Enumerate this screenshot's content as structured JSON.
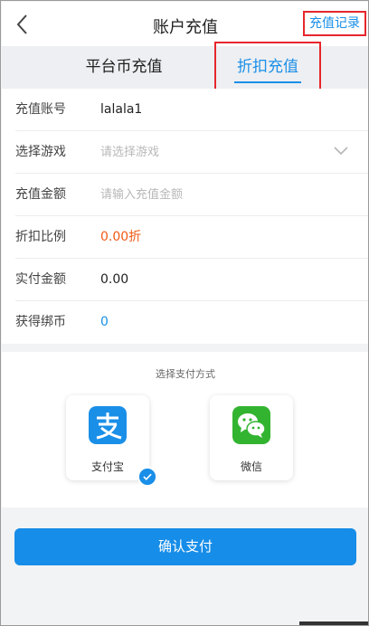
{
  "header": {
    "title": "账户充值",
    "history_label": "充值记录",
    "back_icon": "chevron-left-icon"
  },
  "tabs": [
    {
      "label": "平台币充值",
      "active": false
    },
    {
      "label": "折扣充值",
      "active": true
    }
  ],
  "form": {
    "account": {
      "label": "充值账号",
      "value": "lalala1"
    },
    "game": {
      "label": "选择游戏",
      "placeholder": "请选择游戏",
      "icon": "chevron-down-icon"
    },
    "amount": {
      "label": "充值金额",
      "placeholder": "请输入充值金额"
    },
    "discount": {
      "label": "折扣比例",
      "value": "0.00折"
    },
    "pay_amount": {
      "label": "实付金额",
      "value": "0.00"
    },
    "bonus": {
      "label": "获得绑币",
      "value": "0"
    }
  },
  "payment": {
    "title": "选择支付方式",
    "methods": [
      {
        "label": "支付宝",
        "icon": "alipay-icon",
        "color": "#1a8fe8",
        "selected": true
      },
      {
        "label": "微信",
        "icon": "wechat-icon",
        "color": "#33b431",
        "selected": false
      }
    ]
  },
  "confirm_label": "确认支付",
  "colors": {
    "accent": "#1a8fe8",
    "highlight_border": "#e6262c",
    "discount_text": "#f05a14"
  }
}
